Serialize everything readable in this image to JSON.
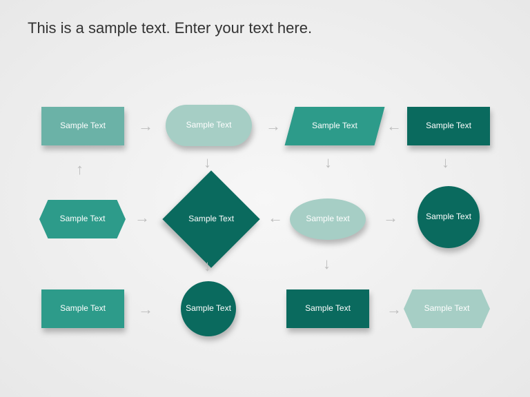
{
  "title": "This is a sample text. Enter your text here.",
  "row1": {
    "a": "Sample Text",
    "b": "Sample Text",
    "c": "Sample Text",
    "d": "Sample Text"
  },
  "row2": {
    "a": "Sample Text",
    "b": "Sample Text",
    "c": "Sample text",
    "d": "Sample Text"
  },
  "row3": {
    "a": "Sample Text",
    "b": "Sample Text",
    "c": "Sample Text",
    "d": "Sample Text"
  }
}
